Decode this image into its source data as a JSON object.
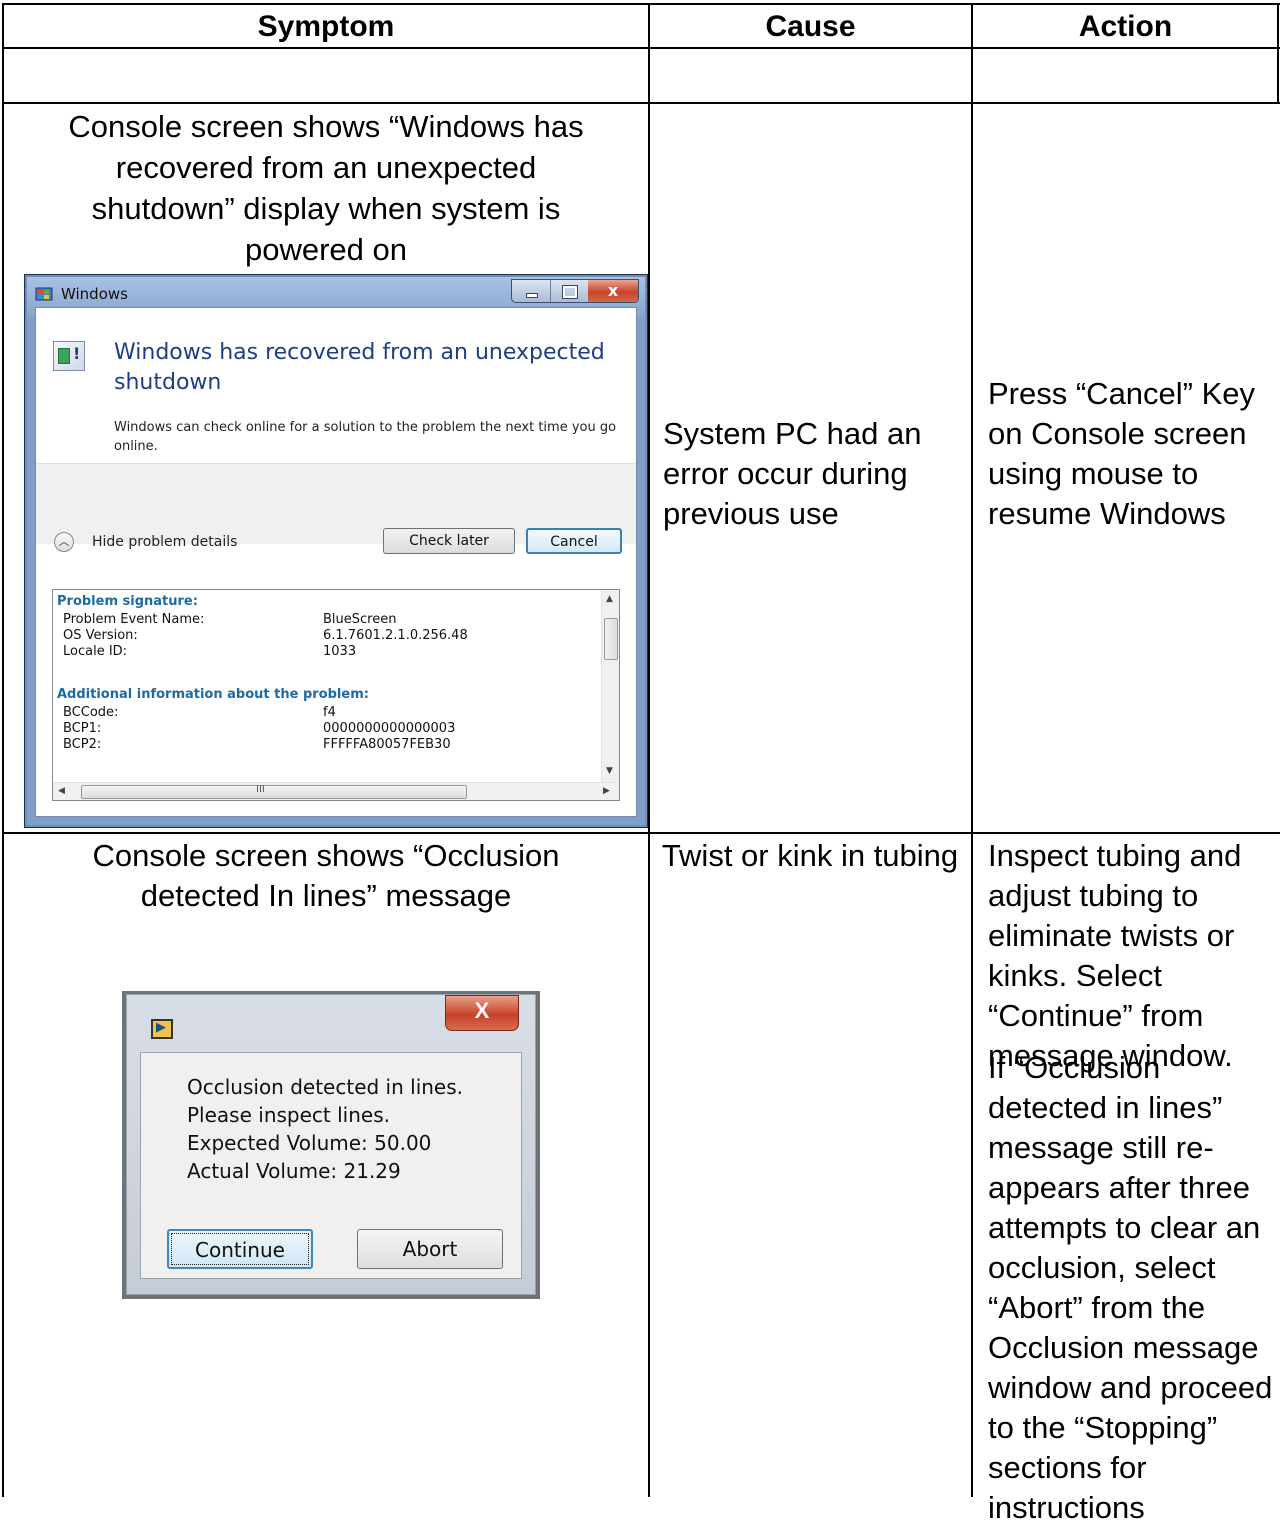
{
  "headers": {
    "symptom": "Symptom",
    "cause": "Cause",
    "action": "Action"
  },
  "rows": [
    {
      "symptom": "Console screen shows “Windows has recovered from an unexpected shutdown” display when system is powered on",
      "cause": "System PC had an error occur during previous use",
      "action": "Press “Cancel” Key on Console screen using mouse to resume Windows"
    },
    {
      "symptom": "Console screen shows “Occlusion detected In lines” message",
      "cause": "Twist or kink in tubing",
      "action_p1": "Inspect tubing and adjust tubing to eliminate twists or kinks.  Select “Continue” from message window.",
      "action_p2": "If “Occlusion detected in lines” message still re-appears after three attempts to clear an occlusion, select “Abort” from the Occlusion message window and proceed to the “Stopping” sections for instructions"
    }
  ],
  "win_dialog": {
    "title": "Windows",
    "heading": "Windows has recovered from an unexpected shutdown",
    "body": "Windows can check online for a solution to the problem the next time you go online.",
    "hide_details": "Hide problem details",
    "check_later": "Check later",
    "cancel": "Cancel",
    "close_glyph": "x",
    "problem_signature": "Problem signature:",
    "sig_rows": [
      {
        "label": "Problem Event Name:",
        "value": "BlueScreen"
      },
      {
        "label": "OS Version:",
        "value": "6.1.7601.2.1.0.256.48"
      },
      {
        "label": "Locale ID:",
        "value": "1033"
      }
    ],
    "additional_info": "Additional information about the problem:",
    "add_rows": [
      {
        "label": "BCCode:",
        "value": "f4"
      },
      {
        "label": "BCP1:",
        "value": "0000000000000003"
      },
      {
        "label": "BCP2:",
        "value": "FFFFFA80057FEB30"
      }
    ],
    "scroll_grip": "III"
  },
  "occ_dialog": {
    "close_glyph": "X",
    "line1": "Occlusion detected in lines.",
    "line2": "Please inspect lines.",
    "line3": "Expected Volume: 50.00",
    "line4": "Actual Volume: 21.29",
    "continue": "Continue",
    "abort": "Abort"
  }
}
